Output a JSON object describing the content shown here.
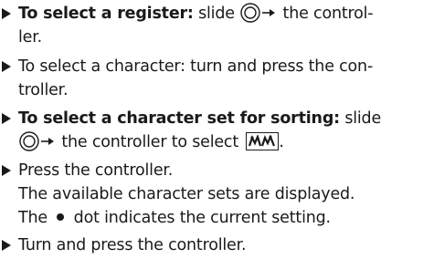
{
  "steps": [
    {
      "bold_prefix": "To select a register:",
      "text_a": " slide ",
      "text_b": " the control-",
      "line2": "ler."
    },
    {
      "line1": "To select a character: turn and press the con-",
      "line2": "troller."
    },
    {
      "bold_prefix": "To select a character set for sorting:",
      "text_a": " slide",
      "text_b": " the controller to select ",
      "text_c": "."
    },
    {
      "line1": "Press the controller.",
      "line2": "The available character sets are displayed.",
      "line3_a": "The ",
      "line3_b": " dot indicates the current setting."
    },
    {
      "line1": "Turn and press the controller."
    }
  ],
  "icons": {
    "controller_slide": "controller-slide-right-icon",
    "sort_charset": "character-set-sort-icon",
    "bullet_dot": "current-setting-dot-icon"
  }
}
